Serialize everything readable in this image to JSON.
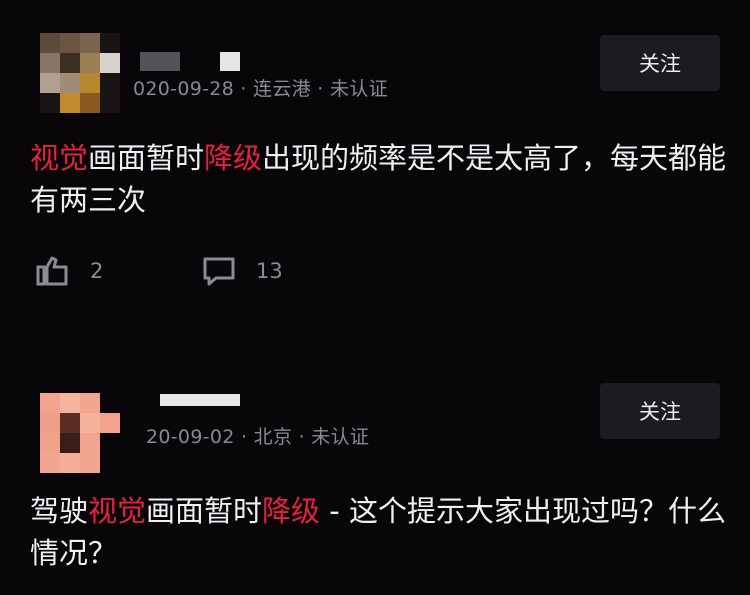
{
  "comments": [
    {
      "meta": "020-09-28 · 连云港 · 未认证",
      "follow_label": "关注",
      "body": {
        "hl1": "视觉",
        "t1": "画面暂时",
        "hl2": "降级",
        "t2": "出现的频率是不是太高了，每天都能有两三次"
      },
      "likes": "2",
      "replies": "13"
    },
    {
      "meta": "20-09-02 · 北京 · 未认证",
      "follow_label": "关注",
      "body": {
        "t0": "驾驶",
        "hl1": "视觉",
        "t1": "画面暂时",
        "hl2": "降级",
        "t2": " - 这个提示大家出现过吗？什么情况？"
      }
    }
  ],
  "colors": {
    "background": "#080609",
    "highlight": "#e6203f",
    "meta_text": "#8b888e",
    "button_bg": "#1d1b20"
  },
  "icons": {
    "like": "thumbs-up-icon",
    "reply": "comment-icon"
  }
}
